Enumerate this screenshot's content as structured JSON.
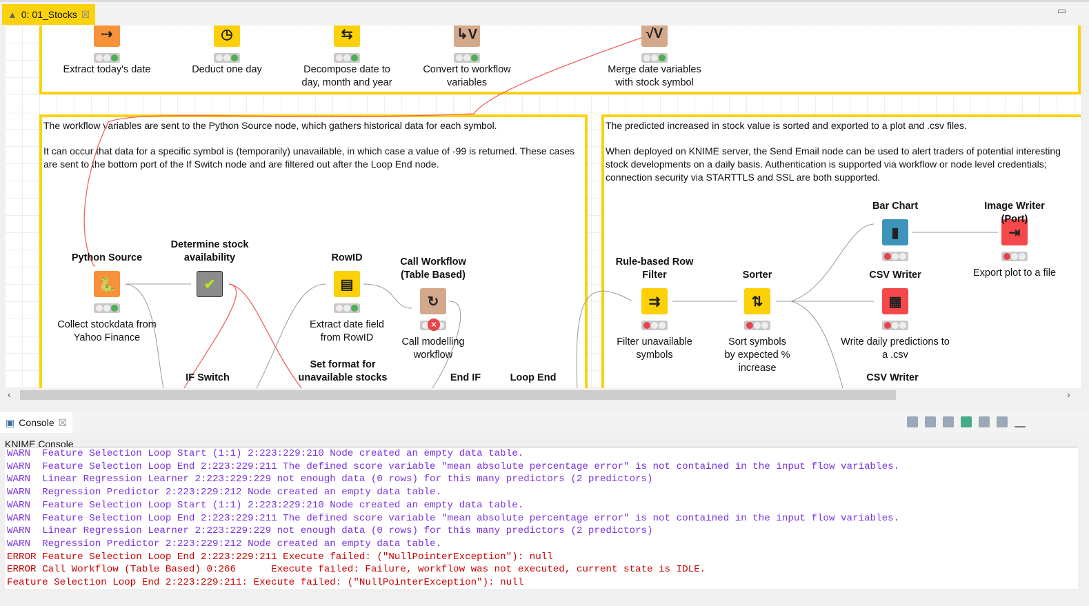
{
  "tab": {
    "title": "0: 01_Stocks",
    "icon": "warning-triangle-icon"
  },
  "annotations": {
    "left": [
      "The workflow variables are sent to the Python Source node, which gathers historical data for each symbol.",
      "It can occur that data for a specific symbol is (temporarily) unavailable, in which case a value of -99 is returned. These cases are sent to the bottom port of the If Switch node and are filtered out after the Loop End node."
    ],
    "right": [
      "The predicted increased in stock value is sorted and exported to a plot and .csv files.",
      "When deployed on KNIME server, the Send Email node can be used to alert traders of potential interesting stock developments on a daily basis. Authentication is supported via workflow or node level credentials; connection security via STARTTLS and SSL are both supported."
    ]
  },
  "nodes": [
    {
      "title": "",
      "desc": "Extract today's date",
      "color": "#f7923a",
      "icon": "⇢",
      "status": "green"
    },
    {
      "title": "",
      "desc": "Deduct one day",
      "color": "#fdd007",
      "icon": "◷",
      "status": "green"
    },
    {
      "title": "",
      "desc": "Decompose date to day, month and year",
      "color": "#fdd007",
      "icon": "⇆",
      "status": "green"
    },
    {
      "title": "",
      "desc": "Convert to workflow variables",
      "color": "#d4a88b",
      "icon": "↳V",
      "status": "green"
    },
    {
      "title": "",
      "desc": "Merge date variables with stock symbol",
      "color": "#d4a88b",
      "icon": "√V",
      "status": "green"
    },
    {
      "title": "Python Source",
      "desc": "Collect stockdata from Yahoo Finance",
      "color": "#f7923a",
      "icon": "🐍",
      "status": "green"
    },
    {
      "title": "Determine stock availability",
      "desc": "",
      "color": "#8c8c8c",
      "icon": "✔",
      "status": "none"
    },
    {
      "title": "RowID",
      "desc": "Extract date field from RowID",
      "color": "#fdd007",
      "icon": "▤",
      "status": "green"
    },
    {
      "title": "Call Workflow (Table Based)",
      "desc": "Call modelling workflow",
      "color": "#d4a88b",
      "icon": "↻",
      "status": "error"
    },
    {
      "title": "Rule-based Row Filter",
      "desc": "Filter unavailable symbols",
      "color": "#fdd007",
      "icon": "⇉",
      "status": "red"
    },
    {
      "title": "Sorter",
      "desc": "Sort symbols by expected % increase",
      "color": "#fdd007",
      "icon": "⇅",
      "status": "red"
    },
    {
      "title": "Bar Chart",
      "desc": "",
      "color": "#3d94bb",
      "icon": "▮",
      "status": "red"
    },
    {
      "title": "Image Writer (Port)",
      "desc": "Export plot to a file",
      "color": "#f4484b",
      "icon": "⇥",
      "status": "red"
    },
    {
      "title": "CSV Writer",
      "desc": "Write daily predictions to a .csv",
      "color": "#f4484b",
      "icon": "▦",
      "status": "red"
    }
  ],
  "cut_titles": [
    "IF Switch",
    "Set format for unavailable stocks",
    "End IF",
    "Loop End",
    "CSV Writer"
  ],
  "console": {
    "tab": "Console",
    "header": "KNIME Console",
    "lines": [
      {
        "level": "warn",
        "text": "WARN  Feature Selection Loop Start (1:1) 2:223:229:210 Node created an empty data table."
      },
      {
        "level": "warn",
        "text": "WARN  Feature Selection Loop End 2:223:229:211 The defined score variable \"mean absolute percentage error\" is not contained in the input flow variables."
      },
      {
        "level": "warn",
        "text": "WARN  Linear Regression Learner 2:223:229:229 not enough data (0 rows) for this many predictors (2 predictors)"
      },
      {
        "level": "warn",
        "text": "WARN  Regression Predictor 2:223:229:212 Node created an empty data table."
      },
      {
        "level": "warn",
        "text": "WARN  Feature Selection Loop Start (1:1) 2:223:229:210 Node created an empty data table."
      },
      {
        "level": "warn",
        "text": "WARN  Feature Selection Loop End 2:223:229:211 The defined score variable \"mean absolute percentage error\" is not contained in the input flow variables."
      },
      {
        "level": "warn",
        "text": "WARN  Linear Regression Learner 2:223:229:229 not enough data (0 rows) for this many predictors (2 predictors)"
      },
      {
        "level": "warn",
        "text": "WARN  Regression Predictor 2:223:229:212 Node created an empty data table."
      },
      {
        "level": "error",
        "text": "ERROR Feature Selection Loop End 2:223:229:211 Execute failed: (\"NullPointerException\"): null"
      },
      {
        "level": "error",
        "text": "ERROR Call Workflow (Table Based) 0:266      Execute failed: Failure, workflow was not executed, current state is IDLE."
      },
      {
        "level": "error",
        "text": "Feature Selection Loop End 2:223:229:211: Execute failed: (\"NullPointerException\"): null"
      }
    ]
  }
}
